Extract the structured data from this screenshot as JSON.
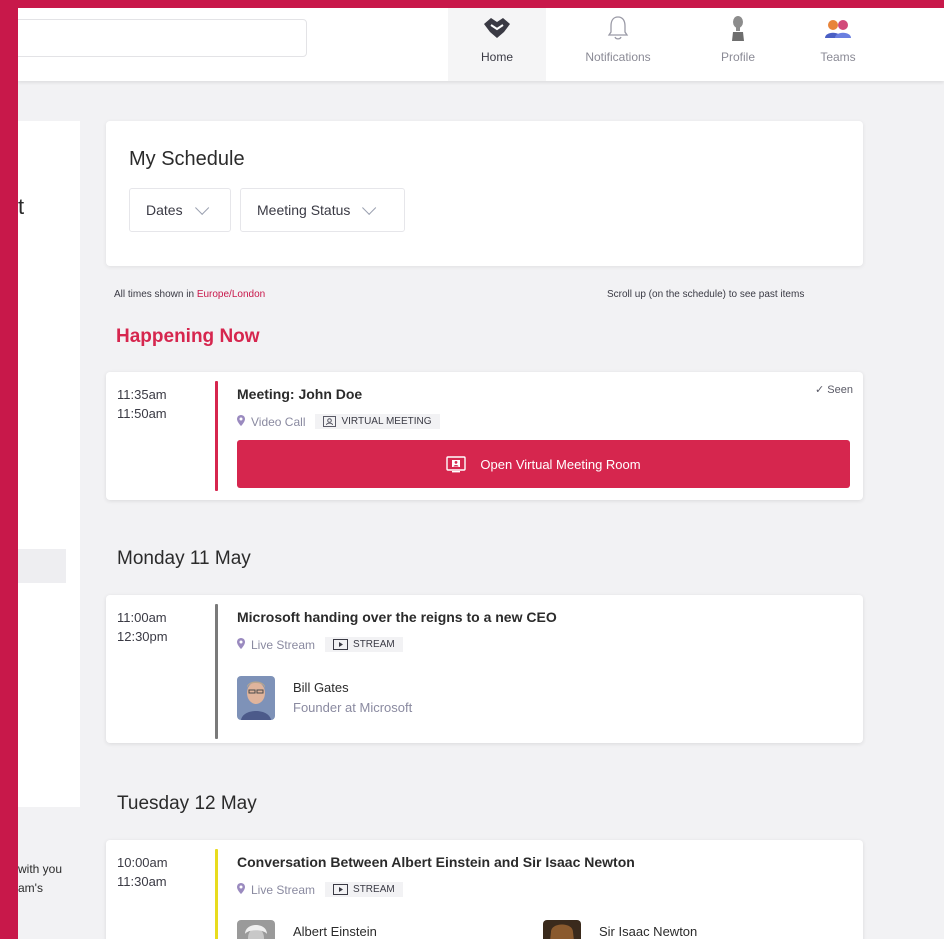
{
  "nav": {
    "home": "Home",
    "notifications": "Notifications",
    "profile": "Profile",
    "teams": "Teams"
  },
  "left": {
    "fragment_char": "t",
    "text_line1": "with you",
    "text_line2": "am's"
  },
  "schedule": {
    "title": "My Schedule",
    "filter_dates": "Dates",
    "filter_status": "Meeting Status"
  },
  "timezone": {
    "prefix": "All times shown in ",
    "value": "Europe/London"
  },
  "scroll_note": "Scroll up (on the schedule) to see past items",
  "happening_now": {
    "heading": "Happening Now",
    "event": {
      "start": "11:35am",
      "end": "11:50am",
      "title": "Meeting: John Doe",
      "location": "Video Call",
      "tag": "VIRTUAL MEETING",
      "seen": "Seen",
      "button": "Open Virtual Meeting Room",
      "bar_color": "#d6264e"
    }
  },
  "days": [
    {
      "heading": "Monday 11 May",
      "event": {
        "start": "11:00am",
        "end": "12:30pm",
        "title": "Microsoft handing over the reigns to a new CEO",
        "location": "Live Stream",
        "tag": "STREAM",
        "bar_color": "#7a7a7a",
        "speakers": [
          {
            "name": "Bill Gates",
            "role": "Founder at Microsoft"
          }
        ]
      }
    },
    {
      "heading": "Tuesday 12 May",
      "event": {
        "start": "10:00am",
        "end": "11:30am",
        "title": "Conversation Between Albert Einstein and Sir Isaac Newton",
        "location": "Live Stream",
        "tag": "STREAM",
        "bar_color": "#e8dc1e",
        "speakers": [
          {
            "name": "Albert Einstein"
          },
          {
            "name": "Sir Isaac Newton"
          }
        ]
      }
    }
  ]
}
